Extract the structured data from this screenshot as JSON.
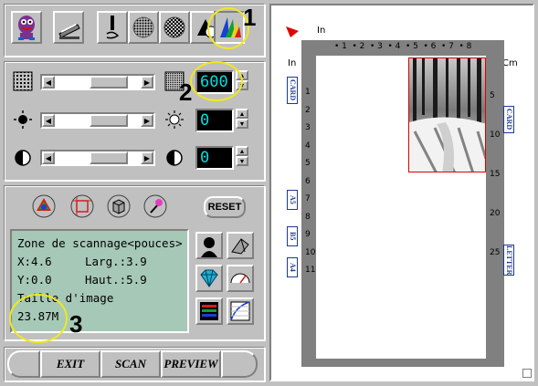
{
  "toolbar": {
    "buttons": [
      {
        "name": "mascot-icon"
      },
      {
        "name": "scanner-icon"
      },
      {
        "name": "line-art-icon"
      },
      {
        "name": "halftone-icon"
      },
      {
        "name": "grayscale-icon"
      },
      {
        "name": "bw-color-icon"
      },
      {
        "name": "color-icon"
      }
    ],
    "callout": "1"
  },
  "adjust": {
    "resolution_value": "600",
    "brightness_value": "0",
    "contrast_value": "0",
    "callout": "2"
  },
  "tools": {
    "reset_label": "RESET"
  },
  "info": {
    "title": "Zone de scannage<pouces>",
    "x": "X:4.6",
    "larg": "Larg.:3.9",
    "y": "Y:0.0",
    "haut": "Haut.:5.9",
    "size_label": "Taille d'image",
    "size_value": "23.87M",
    "callout": "3"
  },
  "bottom": {
    "exit": "EXIT",
    "scan": "SCAN",
    "preview": "PREVIEW"
  },
  "preview": {
    "top_unit": "In",
    "left_unit": "In",
    "right_unit": "Cm",
    "top_ticks": [
      "1",
      "2",
      "3",
      "4",
      "5",
      "6",
      "7",
      "8"
    ],
    "left_ticks": [
      "1",
      "2",
      "3",
      "4",
      "5",
      "6",
      "7",
      "8",
      "9",
      "10",
      "11"
    ],
    "right_ticks": [
      "5",
      "10",
      "15",
      "20",
      "25"
    ],
    "left_tabs": [
      "CARD",
      "A5",
      "B5",
      "A4"
    ],
    "right_tabs": [
      "CARD",
      "LETTER"
    ]
  }
}
